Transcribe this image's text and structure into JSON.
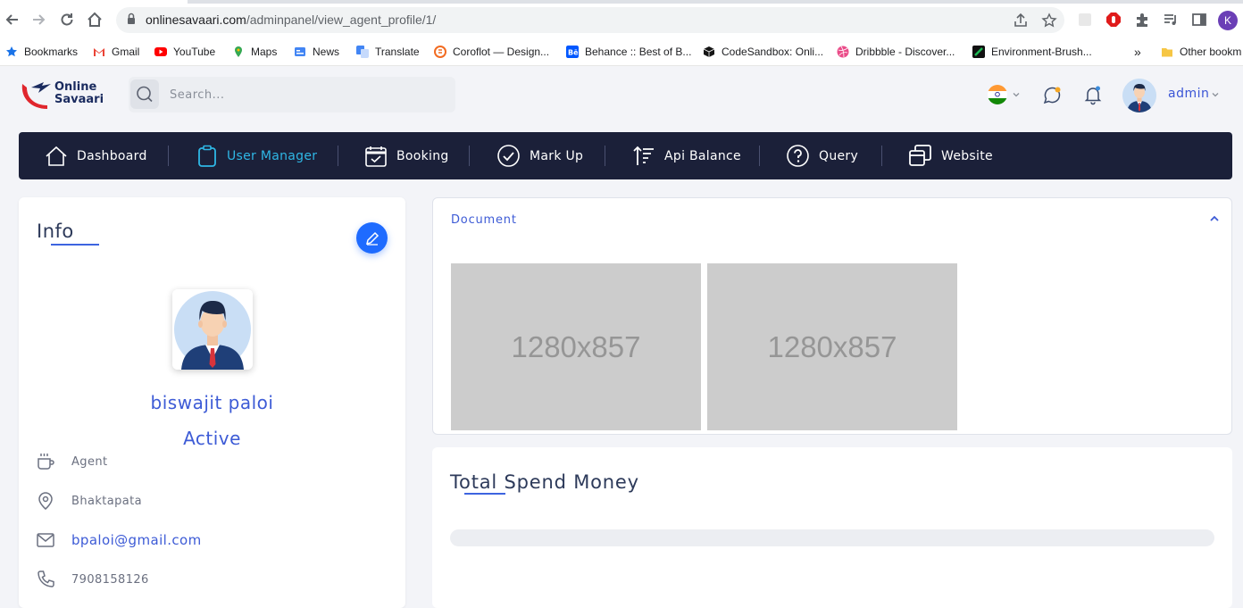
{
  "browser": {
    "url_host": "onlinesavaari.com",
    "url_path": "/adminpanel/view_agent_profile/1/",
    "profile_initial": "K",
    "bookmarks": [
      {
        "label": "Bookmarks",
        "color": "#1a73e8"
      },
      {
        "label": "Gmail",
        "color": "#ea4335"
      },
      {
        "label": "YouTube",
        "color": "#ff0000"
      },
      {
        "label": "Maps",
        "color": "#34a853"
      },
      {
        "label": "News",
        "color": "#4285f4"
      },
      {
        "label": "Translate",
        "color": "#4285f4"
      },
      {
        "label": "Coroflot — Design...",
        "color": "#f26b21"
      },
      {
        "label": "Behance :: Best of B...",
        "color": "#0057ff"
      },
      {
        "label": "CodeSandbox: Onli...",
        "color": "#151515"
      },
      {
        "label": "Dribbble - Discover...",
        "color": "#ea4c89"
      },
      {
        "label": "Environment-Brush...",
        "color": "#1db954"
      },
      {
        "label": "Other bookm",
        "color": "#f6c644"
      }
    ],
    "more_bookmarks": "»"
  },
  "app": {
    "logo_line1": "Online",
    "logo_line2": "Savaari",
    "search_placeholder": "Search...",
    "user_name": "admin",
    "accent": "#3d5bd6",
    "navbar_bg": "#1b2039",
    "nav": [
      {
        "label": "Dashboard",
        "icon": "home-icon"
      },
      {
        "label": "User Manager",
        "icon": "clipboard-icon",
        "active": true
      },
      {
        "label": "Booking",
        "icon": "calendar-icon"
      },
      {
        "label": "Mark Up",
        "icon": "check-circle-icon"
      },
      {
        "label": "Api Balance",
        "icon": "sort-icon"
      },
      {
        "label": "Query",
        "icon": "help-circle-icon"
      },
      {
        "label": "Website",
        "icon": "windows-icon"
      }
    ]
  },
  "info": {
    "title": "Info",
    "name": "biswajit paloi",
    "status": "Active",
    "rows": [
      {
        "icon": "coffee-icon",
        "text": "Agent"
      },
      {
        "icon": "map-pin-icon",
        "text": "Bhaktapata"
      },
      {
        "icon": "mail-icon",
        "text": "bpaloi@gmail.com"
      },
      {
        "icon": "phone-icon",
        "text": "7908158126"
      }
    ]
  },
  "document": {
    "title": "Document",
    "images": [
      "1280x857",
      "1280x857"
    ]
  },
  "spend": {
    "title": "Total Spend Money",
    "progress": 0
  }
}
